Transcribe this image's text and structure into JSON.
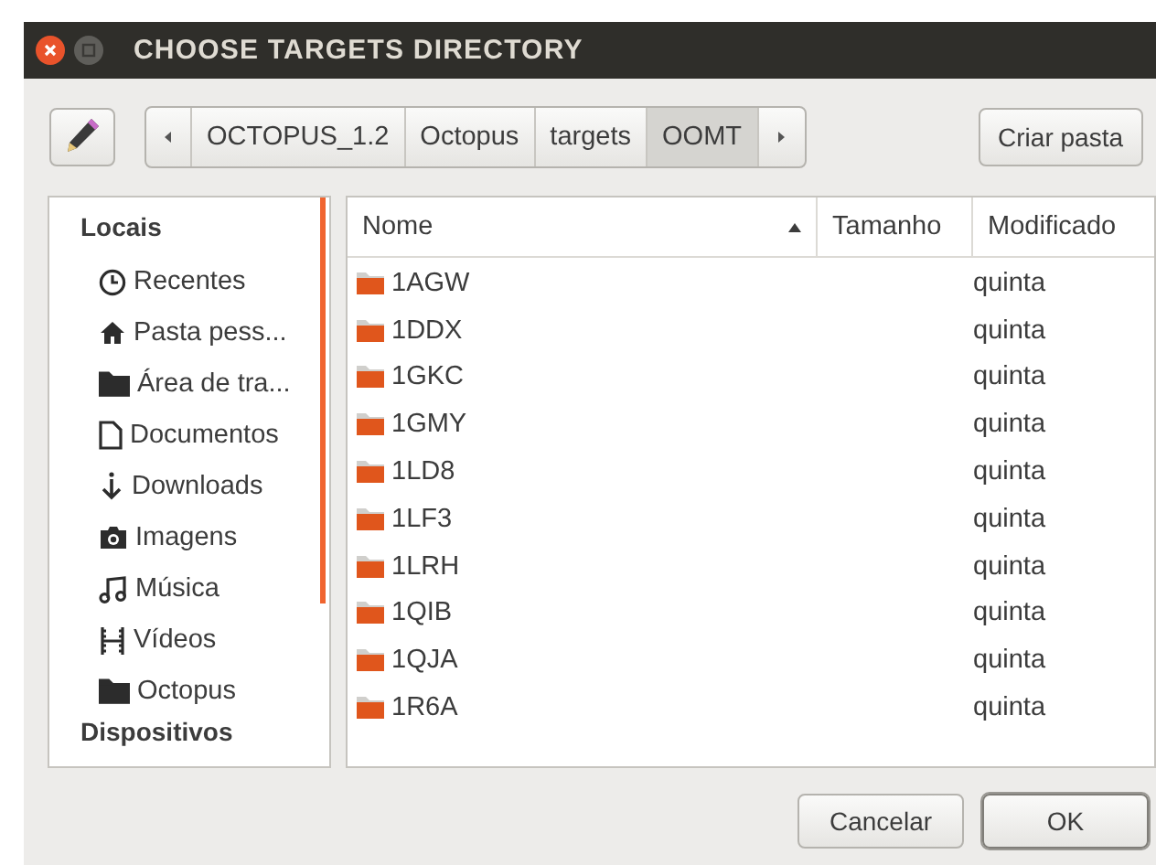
{
  "window": {
    "title": "CHOOSE TARGETS DIRECTORY"
  },
  "path_bar": {
    "segments": [
      {
        "label": "OCTOPUS_1.2",
        "selected": false
      },
      {
        "label": "Octopus",
        "selected": false
      },
      {
        "label": "targets",
        "selected": false
      },
      {
        "label": "OOMT",
        "selected": true
      }
    ]
  },
  "create_folder_button": "Criar pasta",
  "sidebar": {
    "sections": [
      {
        "title": "Locais",
        "items": [
          {
            "label": "Recentes",
            "kind": "clock"
          },
          {
            "label": "Pasta pess...",
            "kind": "home"
          },
          {
            "label": "Área de tra...",
            "kind": "folder"
          },
          {
            "label": "Documentos",
            "kind": "document"
          },
          {
            "label": "Downloads",
            "kind": "download"
          },
          {
            "label": "Imagens",
            "kind": "camera"
          },
          {
            "label": "Música",
            "kind": "music"
          },
          {
            "label": "Vídeos",
            "kind": "film"
          },
          {
            "label": "Octopus",
            "kind": "folder"
          }
        ]
      },
      {
        "title": "Dispositivos"
      }
    ]
  },
  "table": {
    "columns": [
      {
        "label": "Nome",
        "sorted": true
      },
      {
        "label": "Tamanho",
        "sorted": false
      },
      {
        "label": "Modificado",
        "sorted": false
      }
    ],
    "rows": [
      {
        "name": "1AGW",
        "modified": "quinta"
      },
      {
        "name": "1DDX",
        "modified": "quinta"
      },
      {
        "name": "1GKC",
        "modified": "quinta"
      },
      {
        "name": "1GMY",
        "modified": "quinta"
      },
      {
        "name": "1LD8",
        "modified": "quinta"
      },
      {
        "name": "1LF3",
        "modified": "quinta"
      },
      {
        "name": "1LRH",
        "modified": "quinta"
      },
      {
        "name": "1QIB",
        "modified": "quinta"
      },
      {
        "name": "1QJA",
        "modified": "quinta"
      },
      {
        "name": "1R6A",
        "modified": "quinta"
      }
    ]
  },
  "buttons": [
    {
      "label": "Cancelar",
      "default": false
    },
    {
      "label": "OK",
      "default": true
    }
  ]
}
